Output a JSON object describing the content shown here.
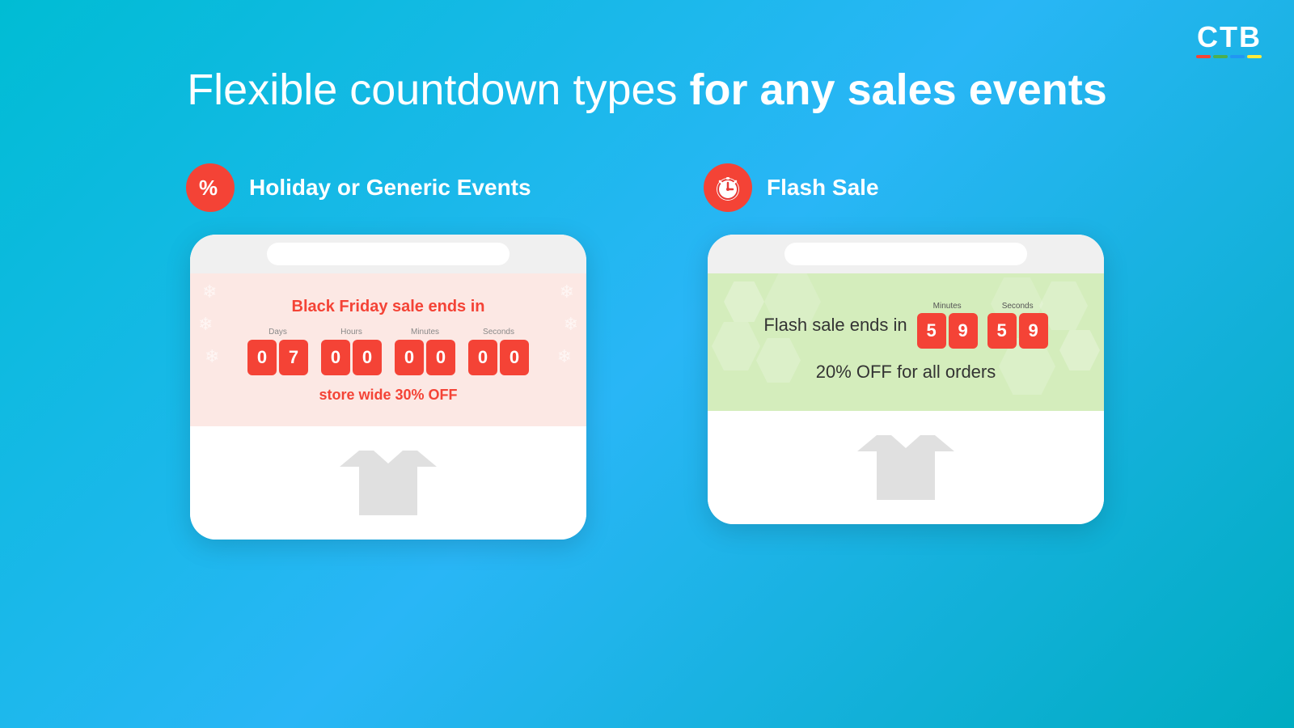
{
  "logo": {
    "letters": "CTB",
    "bars": [
      "red",
      "green",
      "blue",
      "yellow"
    ]
  },
  "heading": {
    "part1": "Flexible countdown types ",
    "part2": "for any sales events"
  },
  "left_column": {
    "icon_type": "percent",
    "label": "Holiday or Generic Events",
    "countdown_title": "Black Friday sale ends in",
    "days_label": "Days",
    "hours_label": "Hours",
    "minutes_label": "Minutes",
    "seconds_label": "Seconds",
    "days": [
      "0",
      "7"
    ],
    "hours": [
      "0",
      "0"
    ],
    "minutes": [
      "0",
      "0"
    ],
    "seconds": [
      "0",
      "0"
    ],
    "subtitle": "store wide 30% OFF"
  },
  "right_column": {
    "icon_type": "clock",
    "label": "Flash Sale",
    "flash_text": "Flash sale ends in",
    "minutes_label": "Minutes",
    "seconds_label": "Seconds",
    "minutes": [
      "5",
      "9"
    ],
    "seconds": [
      "5",
      "9"
    ],
    "discount_text": "20% OFF for all orders"
  }
}
